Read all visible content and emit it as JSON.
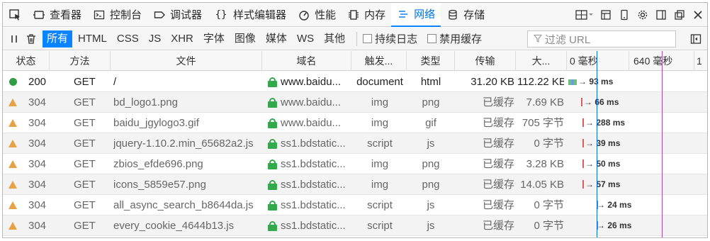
{
  "toolbar": {
    "tabs": [
      {
        "label": "查看器",
        "icon": "inspector-icon"
      },
      {
        "label": "控制台",
        "icon": "console-icon"
      },
      {
        "label": "调试器",
        "icon": "debugger-icon"
      },
      {
        "label": "样式编辑器",
        "icon": "style-editor-icon"
      },
      {
        "label": "性能",
        "icon": "performance-icon"
      },
      {
        "label": "内存",
        "icon": "memory-icon"
      },
      {
        "label": "网络",
        "icon": "network-icon"
      },
      {
        "label": "存储",
        "icon": "storage-icon"
      }
    ],
    "active_tab": "网络"
  },
  "filterbar": {
    "types": [
      "所有",
      "HTML",
      "CSS",
      "JS",
      "XHR",
      "字体",
      "图像",
      "媒体",
      "WS",
      "其他"
    ],
    "active_type": "所有",
    "persist_logs_label": "持续日志",
    "disable_cache_label": "禁用缓存",
    "url_filter_placeholder": "过滤 URL"
  },
  "table": {
    "columns": {
      "status": "状态",
      "method": "方法",
      "file": "文件",
      "domain": "域名",
      "cause": "触发...",
      "type": "类型",
      "transferred": "传输",
      "size": "大...",
      "wf_start": "0 毫秒",
      "wf_mid": "640 毫秒",
      "wf_end": "1"
    },
    "rows": [
      {
        "status": "200",
        "method": "GET",
        "file": "/",
        "domain": "www.baidu...",
        "cause": "document",
        "type": "html",
        "transferred": "31.20 KB",
        "size": "112.22 KB",
        "time": "93 ms",
        "kind": "ok"
      },
      {
        "status": "304",
        "method": "GET",
        "file": "bd_logo1.png",
        "domain": "www.baidu...",
        "cause": "img",
        "type": "png",
        "transferred": "已缓存",
        "size": "7.69 KB",
        "time": "66 ms",
        "kind": "cached"
      },
      {
        "status": "304",
        "method": "GET",
        "file": "baidu_jgylogo3.gif",
        "domain": "www.baidu...",
        "cause": "img",
        "type": "gif",
        "transferred": "已缓存",
        "size": "705 字节",
        "time": "288 ms",
        "kind": "cached"
      },
      {
        "status": "304",
        "method": "GET",
        "file": "jquery-1.10.2.min_65682a2.js",
        "domain": "ss1.bdstatic...",
        "cause": "script",
        "type": "js",
        "transferred": "已缓存",
        "size": "0 字节",
        "time": "39 ms",
        "kind": "cached"
      },
      {
        "status": "304",
        "method": "GET",
        "file": "zbios_efde696.png",
        "domain": "ss1.bdstatic...",
        "cause": "img",
        "type": "png",
        "transferred": "已缓存",
        "size": "3.28 KB",
        "time": "50 ms",
        "kind": "cached"
      },
      {
        "status": "304",
        "method": "GET",
        "file": "icons_5859e57.png",
        "domain": "ss1.bdstatic...",
        "cause": "img",
        "type": "png",
        "transferred": "已缓存",
        "size": "14.05 KB",
        "time": "57 ms",
        "kind": "cached"
      },
      {
        "status": "304",
        "method": "GET",
        "file": "all_async_search_b8644da.js",
        "domain": "ss1.bdstatic...",
        "cause": "script",
        "type": "js",
        "transferred": "已缓存",
        "size": "0 字节",
        "time": "24 ms",
        "kind": "cached"
      },
      {
        "status": "304",
        "method": "GET",
        "file": "every_cookie_4644b13.js",
        "domain": "ss1.bdstatic...",
        "cause": "script",
        "type": "js",
        "transferred": "已缓存",
        "size": "0 字节",
        "time": "26 ms",
        "kind": "cached"
      }
    ]
  },
  "colors": {
    "accent": "#0a84ff",
    "status_ok": "#2e9e44",
    "status_cached": "#e8a246",
    "lock": "#33a84c",
    "dom_content_loaded_line": "#0a6fd6",
    "load_line": "#b04ab0"
  }
}
